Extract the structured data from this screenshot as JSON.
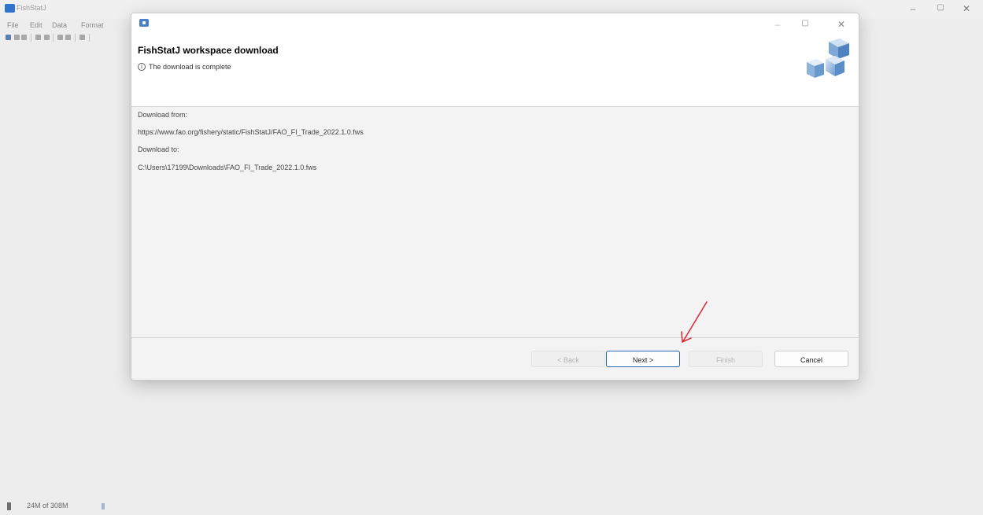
{
  "app": {
    "title": "FishStatJ",
    "menu": [
      "File",
      "Edit",
      "Data",
      "Format"
    ],
    "window_controls": [
      "–",
      "▢",
      "✕"
    ],
    "status_memory": "24M of 308M"
  },
  "dialog": {
    "window_controls": [
      "–",
      "▢",
      "✕"
    ],
    "title": "FishStatJ workspace download",
    "message": "The download is complete",
    "download_from_label": "Download from:",
    "download_from_url": "https://www.fao.org/fishery/static/FishStatJ/FAO_FI_Trade_2022.1.0.fws",
    "download_to_label": "Download to:",
    "download_to_path": "C:\\Users\\17199\\Downloads\\FAO_FI_Trade_2022.1.0.fws",
    "buttons": {
      "back": "< Back",
      "next": "Next >",
      "finish": "Finish",
      "cancel": "Cancel"
    }
  },
  "colors": {
    "annotation_arrow": "#d9303a",
    "primary_border": "#2b67b3"
  }
}
